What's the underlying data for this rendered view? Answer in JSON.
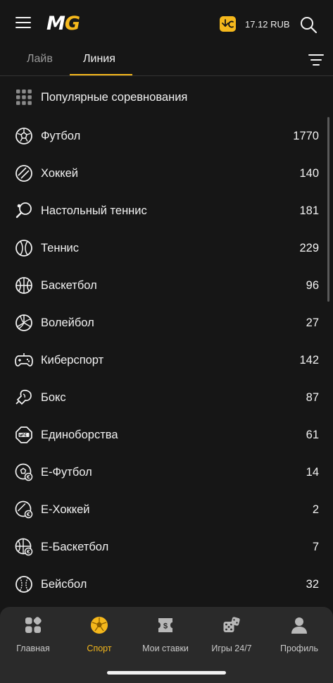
{
  "header": {
    "logo_m": "M",
    "logo_g": "G",
    "balance": "17.12 RUB"
  },
  "tabs": [
    {
      "label": "Лайв",
      "active": false
    },
    {
      "label": "Линия",
      "active": true
    }
  ],
  "colors": {
    "accent": "#f5b81c",
    "background": "#161616",
    "nav_background": "#2a2a2a"
  },
  "sports": [
    {
      "label": "Популярные соревнования",
      "count": "",
      "icon": "grid-icon"
    },
    {
      "label": "Футбол",
      "count": "1770",
      "icon": "football-icon"
    },
    {
      "label": "Хоккей",
      "count": "140",
      "icon": "hockey-puck-icon"
    },
    {
      "label": "Настольный теннис",
      "count": "181",
      "icon": "table-tennis-icon"
    },
    {
      "label": "Теннис",
      "count": "229",
      "icon": "tennis-ball-icon"
    },
    {
      "label": "Баскетбол",
      "count": "96",
      "icon": "basketball-icon"
    },
    {
      "label": "Волейбол",
      "count": "27",
      "icon": "volleyball-icon"
    },
    {
      "label": "Киберспорт",
      "count": "142",
      "icon": "gamepad-icon"
    },
    {
      "label": "Бокс",
      "count": "87",
      "icon": "boxing-glove-icon"
    },
    {
      "label": "Единоборства",
      "count": "61",
      "icon": "ufc-icon"
    },
    {
      "label": "E-Футбол",
      "count": "14",
      "icon": "e-football-icon"
    },
    {
      "label": "E-Хоккей",
      "count": "2",
      "icon": "e-hockey-icon"
    },
    {
      "label": "E-Баскетбол",
      "count": "7",
      "icon": "e-basketball-icon"
    },
    {
      "label": "Бейсбол",
      "count": "32",
      "icon": "baseball-icon"
    }
  ],
  "bottom_nav": [
    {
      "label": "Главная",
      "icon": "home-grid-icon",
      "active": false
    },
    {
      "label": "Спорт",
      "icon": "sport-ball-icon",
      "active": true
    },
    {
      "label": "Мои ставки",
      "icon": "ticket-icon",
      "active": false
    },
    {
      "label": "Игры 24/7",
      "icon": "dice-icon",
      "active": false
    },
    {
      "label": "Профиль",
      "icon": "user-icon",
      "active": false
    }
  ]
}
